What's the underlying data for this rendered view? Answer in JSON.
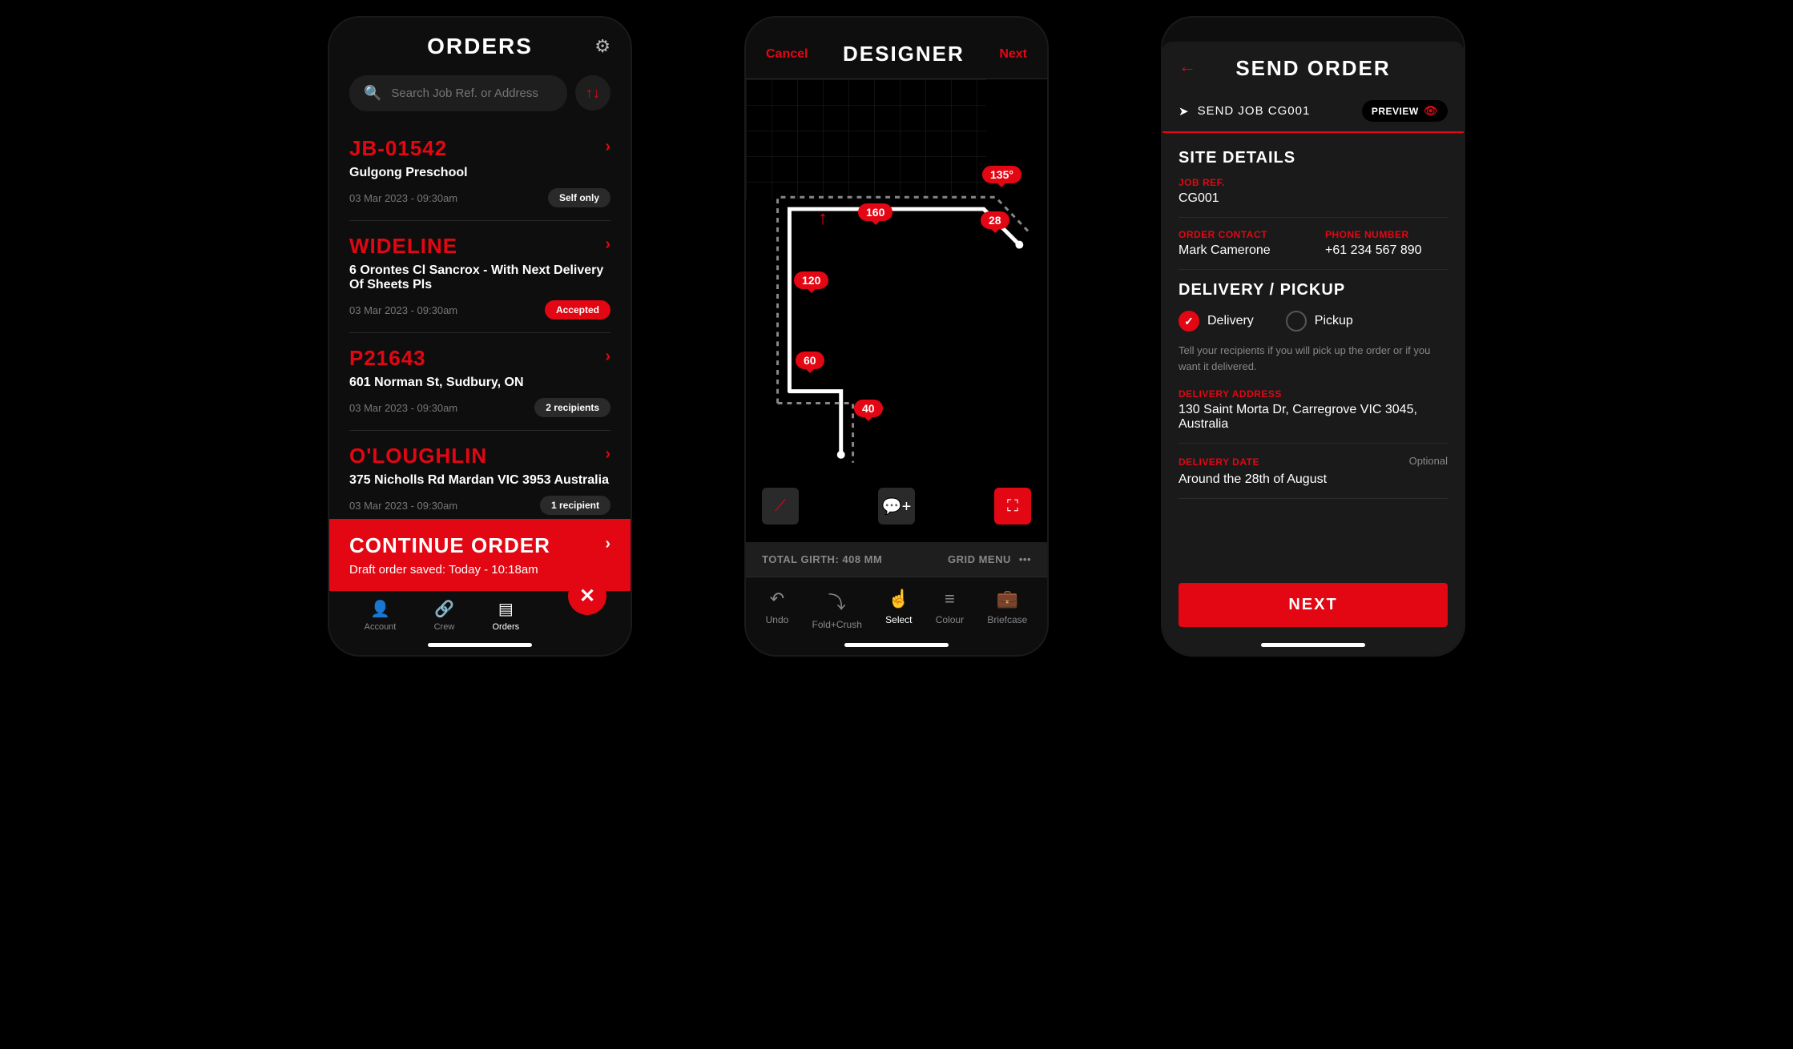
{
  "phone1": {
    "title": "ORDERS",
    "search_placeholder": "Search Job Ref. or Address",
    "orders": [
      {
        "id": "JB-01542",
        "sub": "Gulgong Preschool",
        "date": "03 Mar 2023 - 09:30am",
        "badge": "Self only",
        "badge_style": "gray"
      },
      {
        "id": "WIDELINE",
        "sub": "6 Orontes Cl Sancrox - With Next Delivery Of Sheets Pls",
        "date": "03 Mar 2023 - 09:30am",
        "badge": "Accepted",
        "badge_style": "red"
      },
      {
        "id": "P21643",
        "sub": "601 Norman St, Sudbury, ON",
        "date": "03 Mar 2023 - 09:30am",
        "badge": "2 recipients",
        "badge_style": "gray"
      },
      {
        "id": "O'LOUGHLIN",
        "sub": "375 Nicholls Rd Mardan VIC 3953 Australia",
        "date": "03 Mar 2023 - 09:30am",
        "badge": "1 recipient",
        "badge_style": "gray"
      }
    ],
    "continue": {
      "title": "CONTINUE ORDER",
      "sub": "Draft order saved: Today - 10:18am"
    },
    "tabs": [
      {
        "label": "Account",
        "icon": "👤"
      },
      {
        "label": "Crew",
        "icon": "🔗"
      },
      {
        "label": "Orders",
        "icon": "▤"
      }
    ]
  },
  "phone2": {
    "cancel": "Cancel",
    "title": "DESIGNER",
    "next": "Next",
    "dims": {
      "angle": "135°",
      "top": "160",
      "diag": "28",
      "left_upper": "120",
      "left_lower": "60",
      "bottom": "40"
    },
    "girth": "TOTAL GIRTH: 408 MM",
    "grid_menu": "GRID MENU",
    "tabs": [
      {
        "label": "Undo",
        "icon": "↶"
      },
      {
        "label": "Fold+Crush",
        "icon": "⤵"
      },
      {
        "label": "Select",
        "icon": "☝"
      },
      {
        "label": "Colour",
        "icon": "≡"
      },
      {
        "label": "Briefcase",
        "icon": "💼"
      }
    ]
  },
  "phone3": {
    "title": "SEND ORDER",
    "job_ref_label": "SEND JOB CG001",
    "preview": "PREVIEW",
    "site_details": "SITE DETAILS",
    "job_ref": {
      "label": "JOB REF.",
      "value": "CG001"
    },
    "contact": {
      "label": "ORDER CONTACT",
      "value": "Mark Camerone"
    },
    "phone": {
      "label": "PHONE NUMBER",
      "value": "+61 234 567 890"
    },
    "delivery_pickup": "DELIVERY / PICKUP",
    "opt_delivery": "Delivery",
    "opt_pickup": "Pickup",
    "helper": "Tell your recipients if you will pick up the order or if you want it delivered.",
    "address": {
      "label": "DELIVERY ADDRESS",
      "value": "130 Saint Morta Dr, Carregrove VIC 3045, Australia"
    },
    "date": {
      "label": "DELIVERY DATE",
      "optional": "Optional",
      "value": "Around the 28th of August"
    },
    "next_btn": "NEXT"
  }
}
